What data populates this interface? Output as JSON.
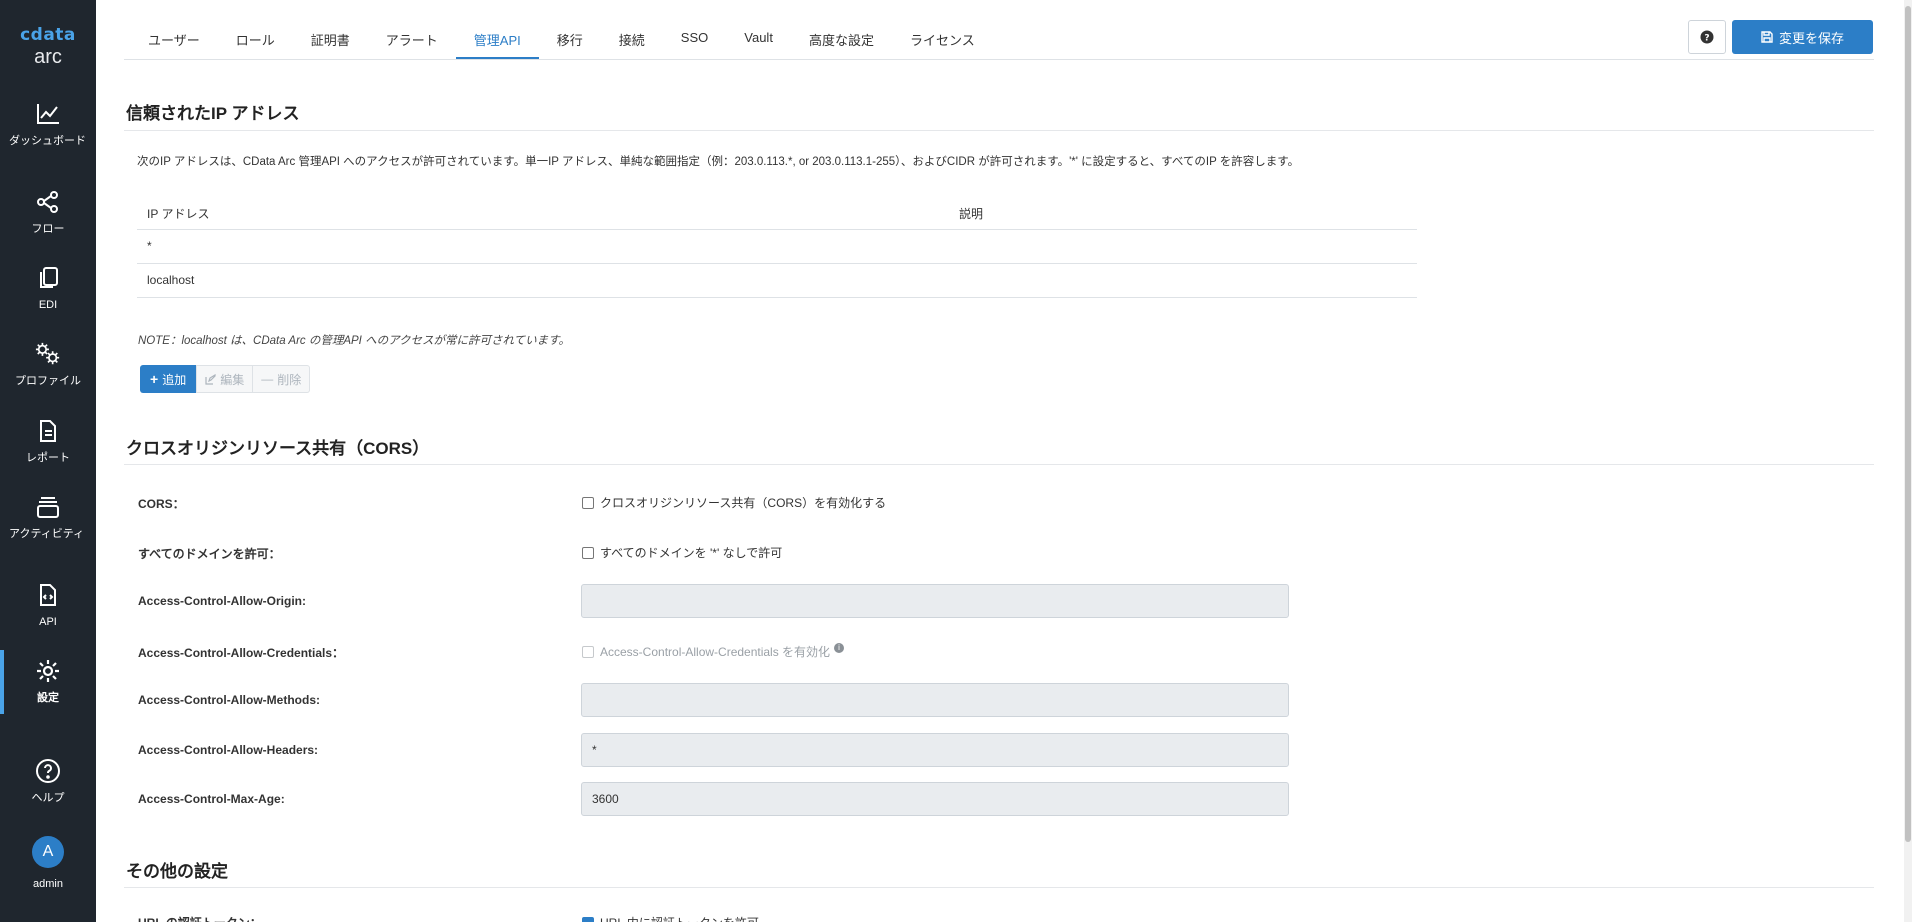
{
  "brand": {
    "logo": "cdata",
    "app": "arc"
  },
  "sidebar": {
    "items": [
      {
        "label": "ダッシュボード",
        "icon": "chart-line-icon"
      },
      {
        "label": "フロー",
        "icon": "flow-icon"
      },
      {
        "label": "EDI",
        "icon": "documents-icon"
      },
      {
        "label": "プロファイル",
        "icon": "gears-icon"
      },
      {
        "label": "レポート",
        "icon": "report-icon"
      },
      {
        "label": "アクティビティ",
        "icon": "activity-icon"
      },
      {
        "label": "API",
        "icon": "api-icon"
      },
      {
        "label": "設定",
        "icon": "gear-icon"
      },
      {
        "label": "ヘルプ",
        "icon": "help-icon"
      }
    ],
    "user": {
      "initial": "A",
      "name": "admin"
    }
  },
  "tabs": [
    "ユーザー",
    "ロール",
    "証明書",
    "アラート",
    "管理API",
    "移行",
    "接続",
    "SSO",
    "Vault",
    "高度な設定",
    "ライセンス"
  ],
  "active_tab": "管理API",
  "toolbar": {
    "save_label": "変更を保存"
  },
  "trusted_ip": {
    "title": "信頼されたIP アドレス",
    "description": "次のIP アドレスは、CData Arc 管理API へのアクセスが許可されています。単一IP アドレス、単純な範囲指定（例：203.0.113.*, or 203.0.113.1-255）、およびCIDR が許可されます。'*' に設定すると、すべてのIP を許容します。",
    "columns": [
      "IP アドレス",
      "説明"
    ],
    "rows": [
      {
        "ip": "*",
        "description": ""
      },
      {
        "ip": "localhost",
        "description": ""
      }
    ],
    "note": "NOTE：localhost は、CData Arc の管理API へのアクセスが常に許可されています。",
    "add_label": "追加",
    "edit_label": "編集",
    "delete_label": "削除"
  },
  "cors": {
    "title": "クロスオリジンリソース共有（CORS）",
    "cors_label": "CORS：",
    "cors_check": "クロスオリジンリソース共有（CORS）を有効化する",
    "all_domains_label": "すべてのドメインを許可：",
    "all_domains_check": "すべてのドメインを '*' なしで許可",
    "origin_label": "Access-Control-Allow-Origin:",
    "origin_value": "",
    "credentials_label": "Access-Control-Allow-Credentials：",
    "credentials_check": "Access-Control-Allow-Credentials を有効化",
    "methods_label": "Access-Control-Allow-Methods:",
    "methods_value": "",
    "headers_label": "Access-Control-Allow-Headers:",
    "headers_value": "*",
    "maxage_label": "Access-Control-Max-Age:",
    "maxage_value": "3600"
  },
  "other": {
    "title": "その他の設定",
    "partial_label": "URL の認証トークン：",
    "partial_check": "URL 内に認証トークンを許可"
  }
}
